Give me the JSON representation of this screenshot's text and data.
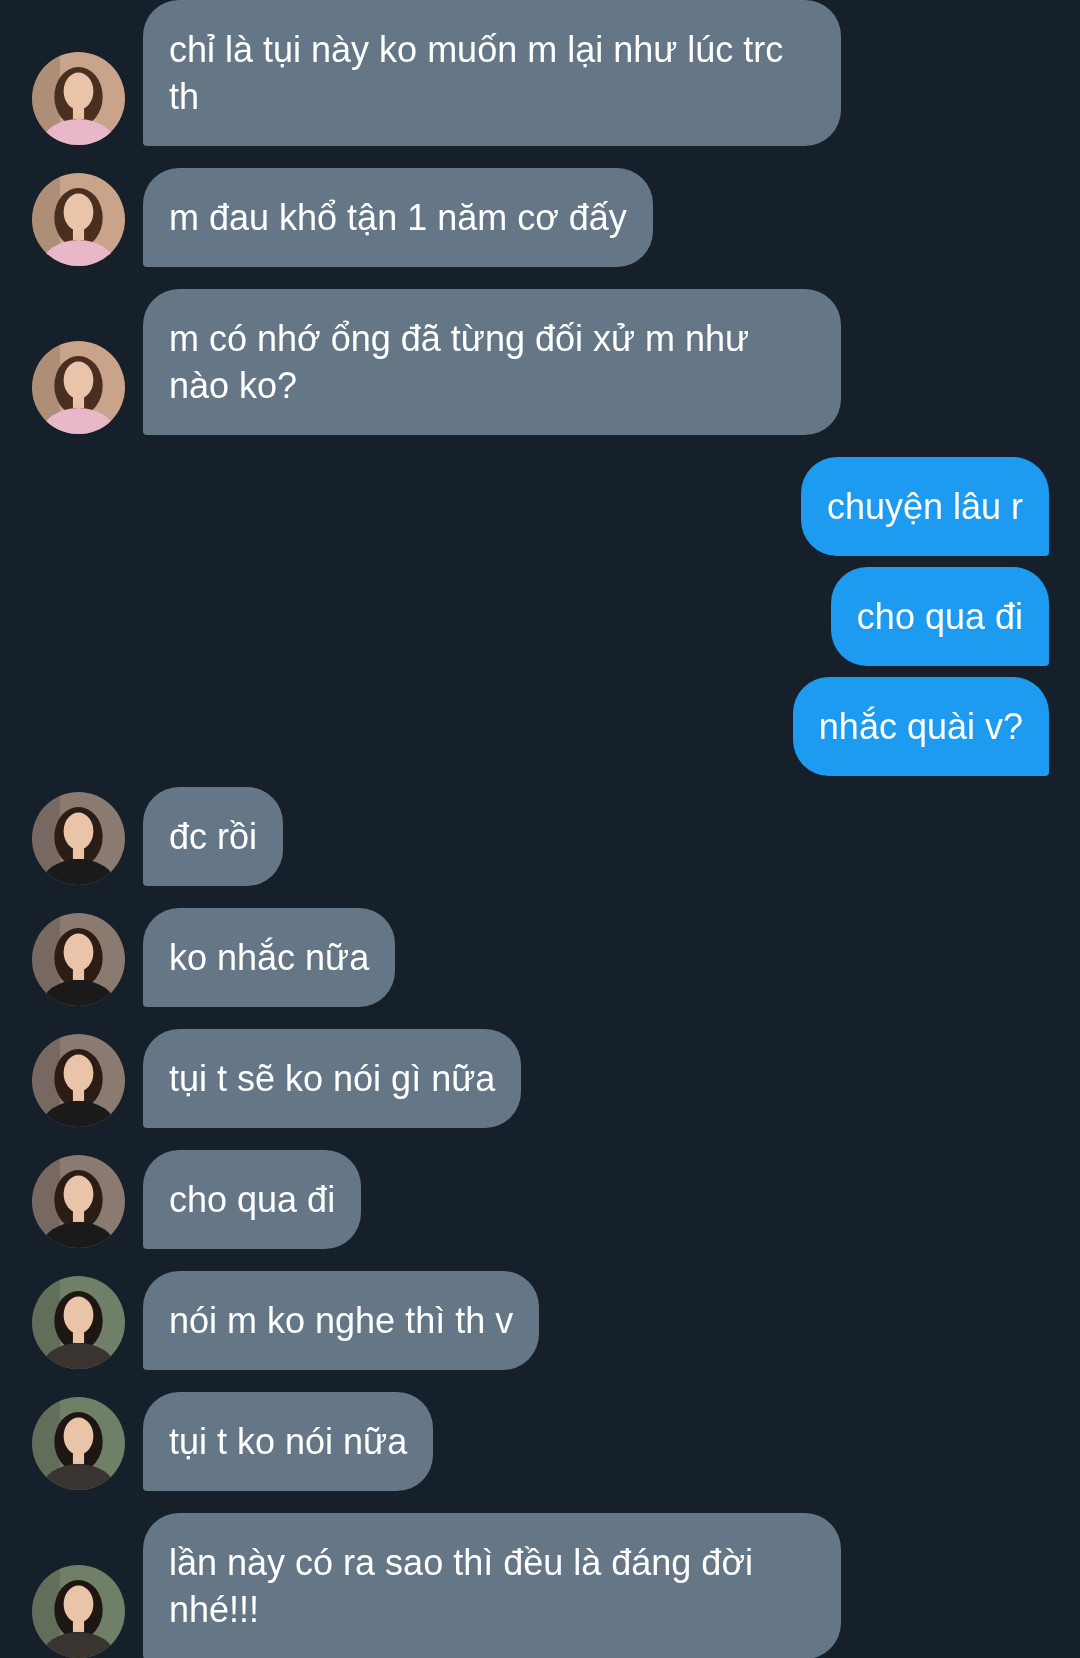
{
  "messages": [
    {
      "kind": "incoming",
      "text": "chỉ là tụi này ko muốn m lại như lúc trc th"
    },
    {
      "kind": "incoming",
      "text": "m đau khổ tận 1 năm cơ đấy"
    },
    {
      "kind": "incoming",
      "text": "m có nhớ ổng đã từng đối xử m như nào ko?"
    },
    {
      "kind": "outgoing",
      "text": "chuyện lâu r"
    },
    {
      "kind": "outgoing",
      "text": "cho qua đi"
    },
    {
      "kind": "outgoing",
      "text": "nhắc quài v?"
    },
    {
      "kind": "incoming",
      "text": "đc rồi"
    },
    {
      "kind": "incoming",
      "text": "ko nhắc nữa"
    },
    {
      "kind": "incoming",
      "text": "tụi t sẽ ko nói gì nữa"
    },
    {
      "kind": "incoming",
      "text": "cho qua đi"
    },
    {
      "kind": "incoming",
      "text": "nói m ko nghe thì th v"
    },
    {
      "kind": "incoming",
      "text": "tụi t ko nói nữa"
    },
    {
      "kind": "incoming",
      "text": "lần này có ra sao thì đều là đáng đời nhé!!!"
    }
  ]
}
